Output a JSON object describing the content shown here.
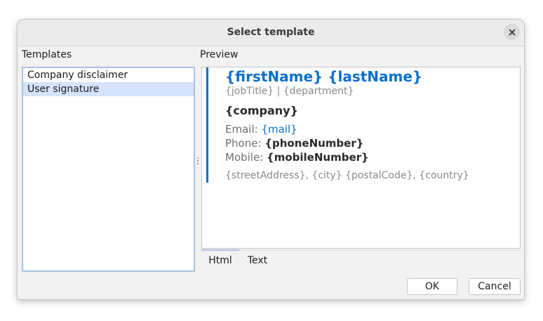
{
  "dialog": {
    "title": "Select template",
    "close_icon": "close-icon"
  },
  "templates": {
    "label": "Templates",
    "items": [
      {
        "label": "Company disclaimer",
        "selected": false
      },
      {
        "label": "User signature",
        "selected": true
      }
    ]
  },
  "preview": {
    "label": "Preview",
    "signature": {
      "name": "{firstName} {lastName}",
      "job": "{jobTitle} | {department}",
      "company": "{company}",
      "email_label": "Email:",
      "email_value": "{mail}",
      "phone_label": "Phone:",
      "phone_value": "{phoneNumber}",
      "mobile_label": "Mobile:",
      "mobile_value": "{mobileNumber}",
      "address": "{streetAddress}, {city} {postalCode}, {country}"
    },
    "tabs": [
      {
        "label": "Html",
        "active": true
      },
      {
        "label": "Text",
        "active": false
      }
    ]
  },
  "buttons": {
    "ok": "OK",
    "cancel": "Cancel"
  },
  "colors": {
    "accent": "#0a70c9",
    "selection": "#d6e3fd",
    "focus_border": "#a8c3e3"
  }
}
